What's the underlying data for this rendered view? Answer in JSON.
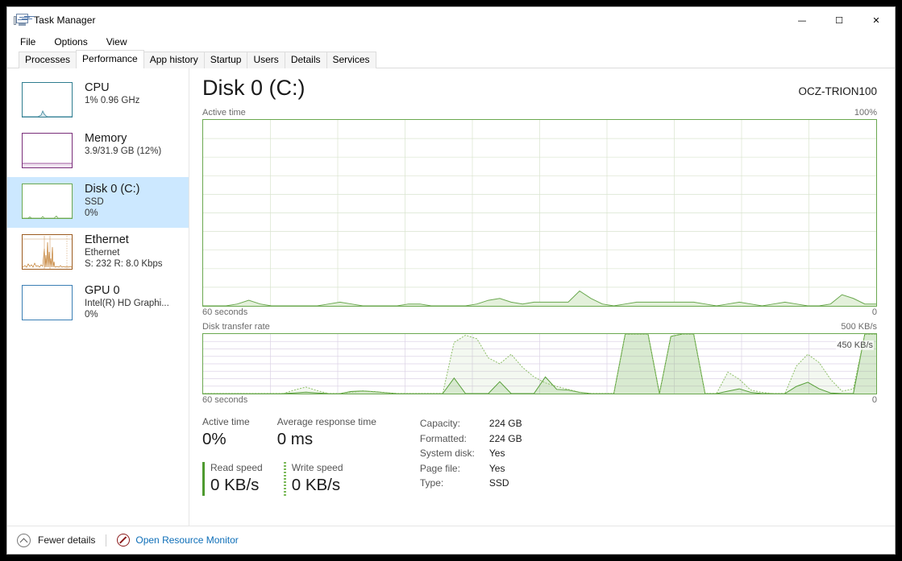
{
  "window": {
    "title": "Task Manager",
    "icon": "task-manager-icon",
    "controls": {
      "minimize": "—",
      "maximize": "☐",
      "close": "✕"
    }
  },
  "menu": {
    "items": [
      "File",
      "Options",
      "View"
    ]
  },
  "tabs": {
    "items": [
      "Processes",
      "Performance",
      "App history",
      "Startup",
      "Users",
      "Details",
      "Services"
    ],
    "active": "Performance"
  },
  "sidebar": {
    "items": [
      {
        "title": "CPU",
        "sub1": "1%  0.96 GHz",
        "sub2": "",
        "color": "#2e7d8f",
        "selected": false
      },
      {
        "title": "Memory",
        "sub1": "3.9/31.9 GB (12%)",
        "sub2": "",
        "color": "#7a2e7a",
        "selected": false
      },
      {
        "title": "Disk 0 (C:)",
        "sub1": "SSD",
        "sub2": "0%",
        "color": "#6aa84f",
        "selected": true
      },
      {
        "title": "Ethernet",
        "sub1": "Ethernet",
        "sub2": "S: 232 R: 8.0 Kbps",
        "color": "#9c5b1f",
        "selected": false
      },
      {
        "title": "GPU 0",
        "sub1": "Intel(R) HD Graphi...",
        "sub2": "0%",
        "color": "#3b7fb5",
        "selected": false
      }
    ]
  },
  "main": {
    "title": "Disk 0 (C:)",
    "model": "OCZ-TRION100",
    "active_graph": {
      "label": "Active time",
      "max_label": "100%",
      "footer_left": "60 seconds",
      "footer_right": "0"
    },
    "transfer_graph": {
      "label": "Disk transfer rate",
      "max_label": "500 KB/s",
      "footer_left": "60 seconds",
      "footer_right": "0",
      "rate_tag": "450 KB/s"
    },
    "stats": {
      "active_time_label": "Active time",
      "active_time_value": "0%",
      "response_label": "Average response time",
      "response_value": "0 ms",
      "read_label": "Read speed",
      "read_value": "0 KB/s",
      "write_label": "Write speed",
      "write_value": "0 KB/s",
      "details": [
        {
          "key": "Capacity:",
          "value": "224 GB"
        },
        {
          "key": "Formatted:",
          "value": "224 GB"
        },
        {
          "key": "System disk:",
          "value": "Yes"
        },
        {
          "key": "Page file:",
          "value": "Yes"
        },
        {
          "key": "Type:",
          "value": "SSD"
        }
      ]
    }
  },
  "footer": {
    "fewer_details": "Fewer details",
    "resource_monitor": "Open Resource Monitor"
  },
  "chart_data": [
    {
      "type": "area",
      "name": "active-time",
      "title": "Active time",
      "ylabel": "%",
      "ylim": [
        0,
        100
      ],
      "xlabel": "60 seconds",
      "grid": true,
      "color": "#6aa84f",
      "fill": "#e3f0da",
      "x": [
        0,
        1,
        2,
        3,
        4,
        5,
        6,
        7,
        8,
        9,
        10,
        11,
        12,
        13,
        14,
        15,
        16,
        17,
        18,
        19,
        20,
        21,
        22,
        23,
        24,
        25,
        26,
        27,
        28,
        29,
        30,
        31,
        32,
        33,
        34,
        35,
        36,
        37,
        38,
        39,
        40,
        41,
        42,
        43,
        44,
        45,
        46,
        47,
        48,
        49,
        50,
        51,
        52,
        53,
        54,
        55,
        56,
        57,
        58,
        59
      ],
      "values": [
        0,
        0,
        0,
        1,
        3,
        1,
        0,
        0,
        0,
        0,
        0,
        1,
        2,
        1,
        0,
        0,
        0,
        0,
        1,
        1,
        0,
        0,
        0,
        0,
        1,
        3,
        4,
        2,
        1,
        2,
        2,
        2,
        2,
        8,
        4,
        1,
        0,
        1,
        2,
        2,
        2,
        2,
        2,
        2,
        1,
        0,
        1,
        2,
        1,
        0,
        1,
        2,
        1,
        0,
        0,
        1,
        6,
        4,
        1,
        1
      ]
    },
    {
      "type": "line",
      "name": "disk-transfer-rate",
      "title": "Disk transfer rate",
      "ylabel": "KB/s",
      "ylim": [
        0,
        500
      ],
      "xlabel": "60 seconds",
      "grid": true,
      "annotation": "450 KB/s",
      "series": [
        {
          "name": "Read speed",
          "style": "solid",
          "color": "#4e9a2f",
          "values": [
            0,
            0,
            0,
            0,
            0,
            0,
            0,
            0,
            5,
            12,
            5,
            0,
            0,
            18,
            22,
            16,
            8,
            0,
            0,
            0,
            0,
            0,
            130,
            0,
            0,
            0,
            100,
            0,
            0,
            0,
            140,
            35,
            30,
            10,
            0,
            0,
            0,
            500,
            520,
            500,
            0,
            480,
            520,
            500,
            0,
            0,
            20,
            40,
            10,
            0,
            0,
            0,
            60,
            95,
            40,
            5,
            0,
            0,
            520,
            510
          ]
        },
        {
          "name": "Write speed",
          "style": "dotted",
          "color": "#8fbf6a",
          "values": [
            0,
            0,
            0,
            0,
            0,
            0,
            0,
            0,
            30,
            55,
            25,
            0,
            0,
            12,
            20,
            14,
            6,
            0,
            0,
            0,
            0,
            0,
            430,
            490,
            460,
            300,
            250,
            330,
            220,
            140,
            90,
            60,
            35,
            12,
            0,
            0,
            0,
            500,
            520,
            500,
            0,
            480,
            520,
            500,
            0,
            0,
            180,
            120,
            30,
            10,
            0,
            0,
            230,
            330,
            260,
            120,
            20,
            40,
            500,
            500
          ]
        }
      ]
    }
  ]
}
